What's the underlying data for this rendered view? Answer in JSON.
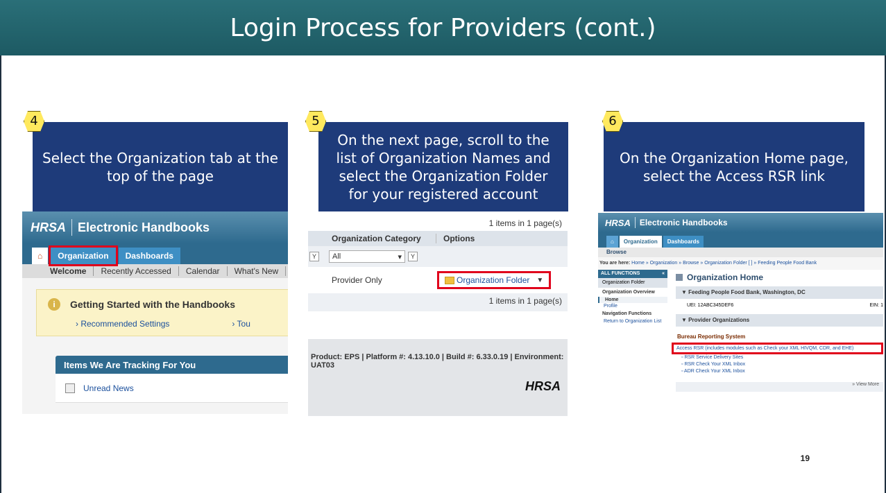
{
  "title": "Login Process for Providers (cont.)",
  "page_number": "19",
  "steps": [
    {
      "badge": "4",
      "text": "Select the Organization tab at the top of the page"
    },
    {
      "badge": "5",
      "text": "On the next page, scroll to the list of Organization Names and select the Organization Folder for your registered account"
    },
    {
      "badge": "6",
      "text": "On the Organization Home page, select the Access RSR link"
    }
  ],
  "shot1": {
    "logo": "HRSA",
    "product": "Electronic Handbooks",
    "tabs": {
      "org": "Organization",
      "dash": "Dashboards"
    },
    "subnav": [
      "Welcome",
      "Recently Accessed",
      "Calendar",
      "What's New"
    ],
    "getting_started": "Getting Started with the Handbooks",
    "links": [
      "Recommended Settings",
      "Tou"
    ],
    "tracking_title": "Items We Are Tracking For You",
    "tracking_item": "Unread News"
  },
  "shot2": {
    "count_top": "1 items in 1 page(s)",
    "col_category": "Organization Category",
    "col_options": "Options",
    "filter_value": "All",
    "row_category": "Provider Only",
    "folder_link": "Organization Folder",
    "count_bottom": "1 items in 1 page(s)",
    "footer": "Product: EPS | Platform #: 4.13.10.0 | Build #: 6.33.0.19 | Environment: UAT03",
    "logo": "HRSA"
  },
  "shot3": {
    "logo": "HRSA",
    "product": "Electronic Handbooks",
    "tabs": {
      "org": "Organization",
      "dash": "Dashboards"
    },
    "browse": "Browse",
    "crumb_label": "You are here:",
    "crumb_path": "Home » Organization » Browse » Organization Folder [ ] » Feeding People Food Bank",
    "all_functions": "ALL FUNCTIONS",
    "org_folder": "Organization Folder",
    "overview": "Organization Overview",
    "home": "Home",
    "profile": "Profile",
    "nav_functions": "Navigation Functions",
    "return_link": "Return to Organization List",
    "org_home_title": "Organization Home",
    "org_name": "Feeding People Food Bank, Washington, DC",
    "uei": "UEI: 12ABC345DEF6",
    "ein": "EIN: 1",
    "provider_orgs": "Provider Organizations",
    "bureau": "Bureau Reporting System",
    "access_rsr": "Access RSR (includes modules such as Check your XML HIVQM, CDR, and EHE)",
    "link2": "RSR Service Delivery Sites",
    "link3": "RSR Check Your XML Inbox",
    "link4": "ADR Check Your XML Inbox",
    "view_more": "» View More"
  }
}
